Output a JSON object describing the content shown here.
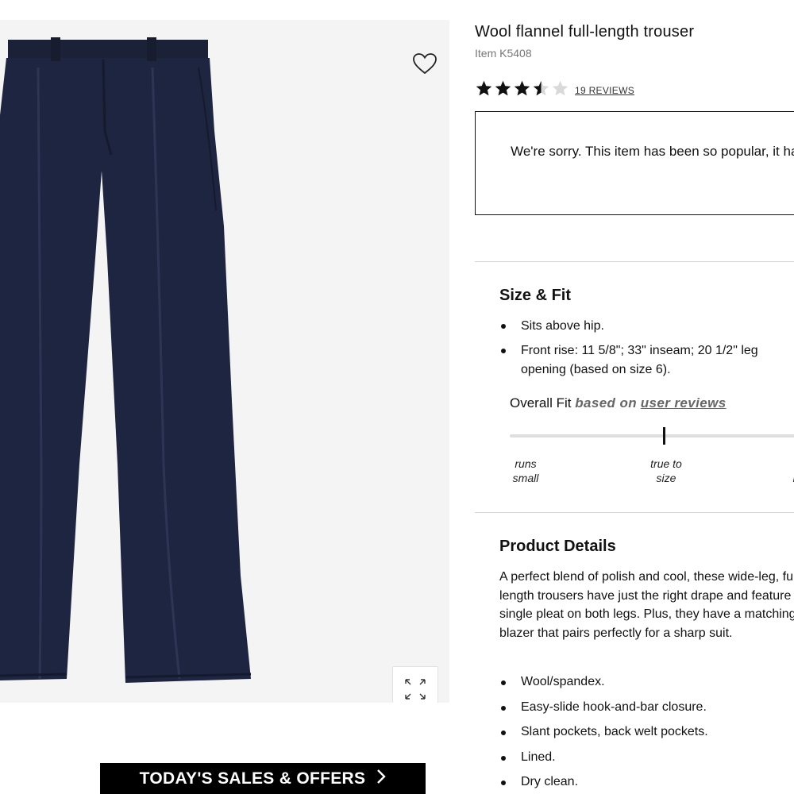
{
  "product": {
    "title": "Wool flannel full-length trouser",
    "item_number": "Item K5408",
    "rating": 3.5,
    "rating_max": 5,
    "reviews_label": "19 REVIEWS",
    "soldout_message": "We're sorry. This item has been so popular, it has sold out."
  },
  "image": {
    "wishlist_icon": "heart-outline-icon",
    "zoom_icon": "expand-arrows-icon",
    "background_color": "#f4f4f4",
    "product_color": "#1e2540"
  },
  "banner": {
    "label": "TODAY'S SALES & OFFERS",
    "chevron": "›"
  },
  "size_fit": {
    "title": "Size & Fit",
    "bullets": [
      "Sits above hip.",
      "Front rise: 11 5/8\"; 33\" inseam; 20 1/2\" leg opening (based on size 6)."
    ],
    "overall_fit_label": "Overall Fit",
    "based_on_label": "based on",
    "user_reviews_label": "user reviews",
    "fit_level": 0.5,
    "scale_runs_small": "runs small",
    "scale_true_to_size": "true to size",
    "scale_runs_large_partial": "r"
  },
  "product_details": {
    "title": "Product Details",
    "description": "A perfect blend of polish and cool, these wide-leg, full-length trousers have just the right drape and feature a single pleat on both legs. Plus, they have a matching blazer that pairs perfectly for a sharp suit.",
    "bullets": [
      "Wool/spandex.",
      "Easy-slide hook-and-bar closure.",
      "Slant pockets, back welt pockets.",
      "Lined.",
      "Dry clean."
    ]
  }
}
